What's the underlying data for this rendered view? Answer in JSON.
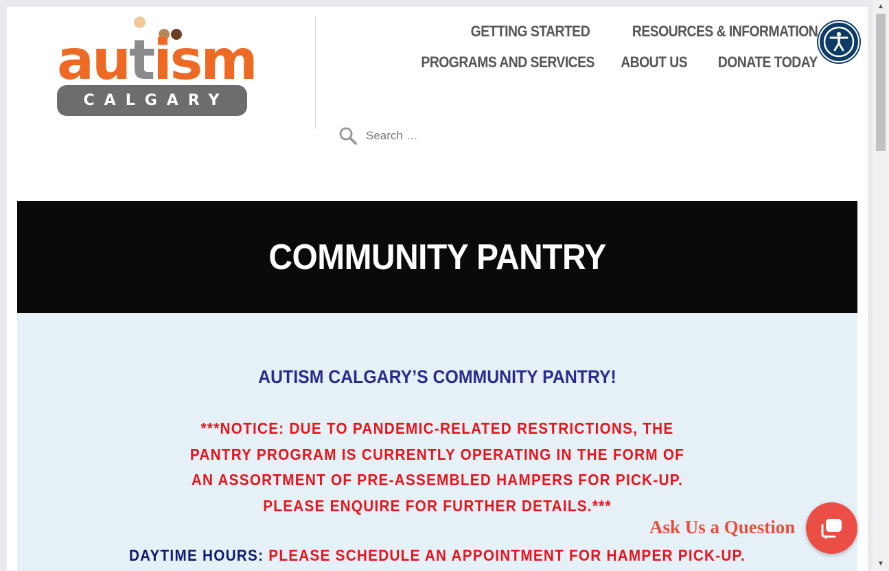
{
  "logo": {
    "word_a": "au",
    "word_t": "t",
    "word_ism": "ism",
    "subtitle": "CALGARY"
  },
  "nav": {
    "items": [
      {
        "label": "GETTING STARTED"
      },
      {
        "label": "RESOURCES & INFORMATION"
      },
      {
        "label": "PROGRAMS AND SERVICES"
      },
      {
        "label": "ABOUT US"
      },
      {
        "label": "DONATE TODAY"
      }
    ]
  },
  "search": {
    "placeholder": "Search …",
    "value": ""
  },
  "hero": {
    "title": "COMMUNITY PANTRY"
  },
  "content": {
    "heading": "AUTISM CALGARY’S COMMUNITY PANTRY!",
    "notice": "***NOTICE: DUE TO PANDEMIC-RELATED RESTRICTIONS, THE PANTRY PROGRAM IS CURRENTLY OPERATING IN THE FORM OF AN ASSORTMENT OF PRE-ASSEMBLED HAMPERS FOR PICK-UP. PLEASE ENQUIRE FOR FURTHER DETAILS.***",
    "hours_label": "DAYTIME HOURS:",
    "hours_value": "PLEASE SCHEDULE AN APPOINTMENT FOR HAMPER PICK-UP."
  },
  "chat": {
    "label": "Ask Us a Question"
  },
  "icons": {
    "accessibility": "accessibility-icon",
    "search": "search-icon",
    "chat": "chat-bubble-icon"
  },
  "colors": {
    "brand_orange": "#ee6a24",
    "nav_text": "#555555",
    "hero_bg": "#0a0a0a",
    "content_bg": "#e6f0f7",
    "heading_blue": "#2b2b8c",
    "notice_red": "#e8141c",
    "chat_red": "#ea4e44",
    "accessibility_blue": "#0d3a66"
  }
}
